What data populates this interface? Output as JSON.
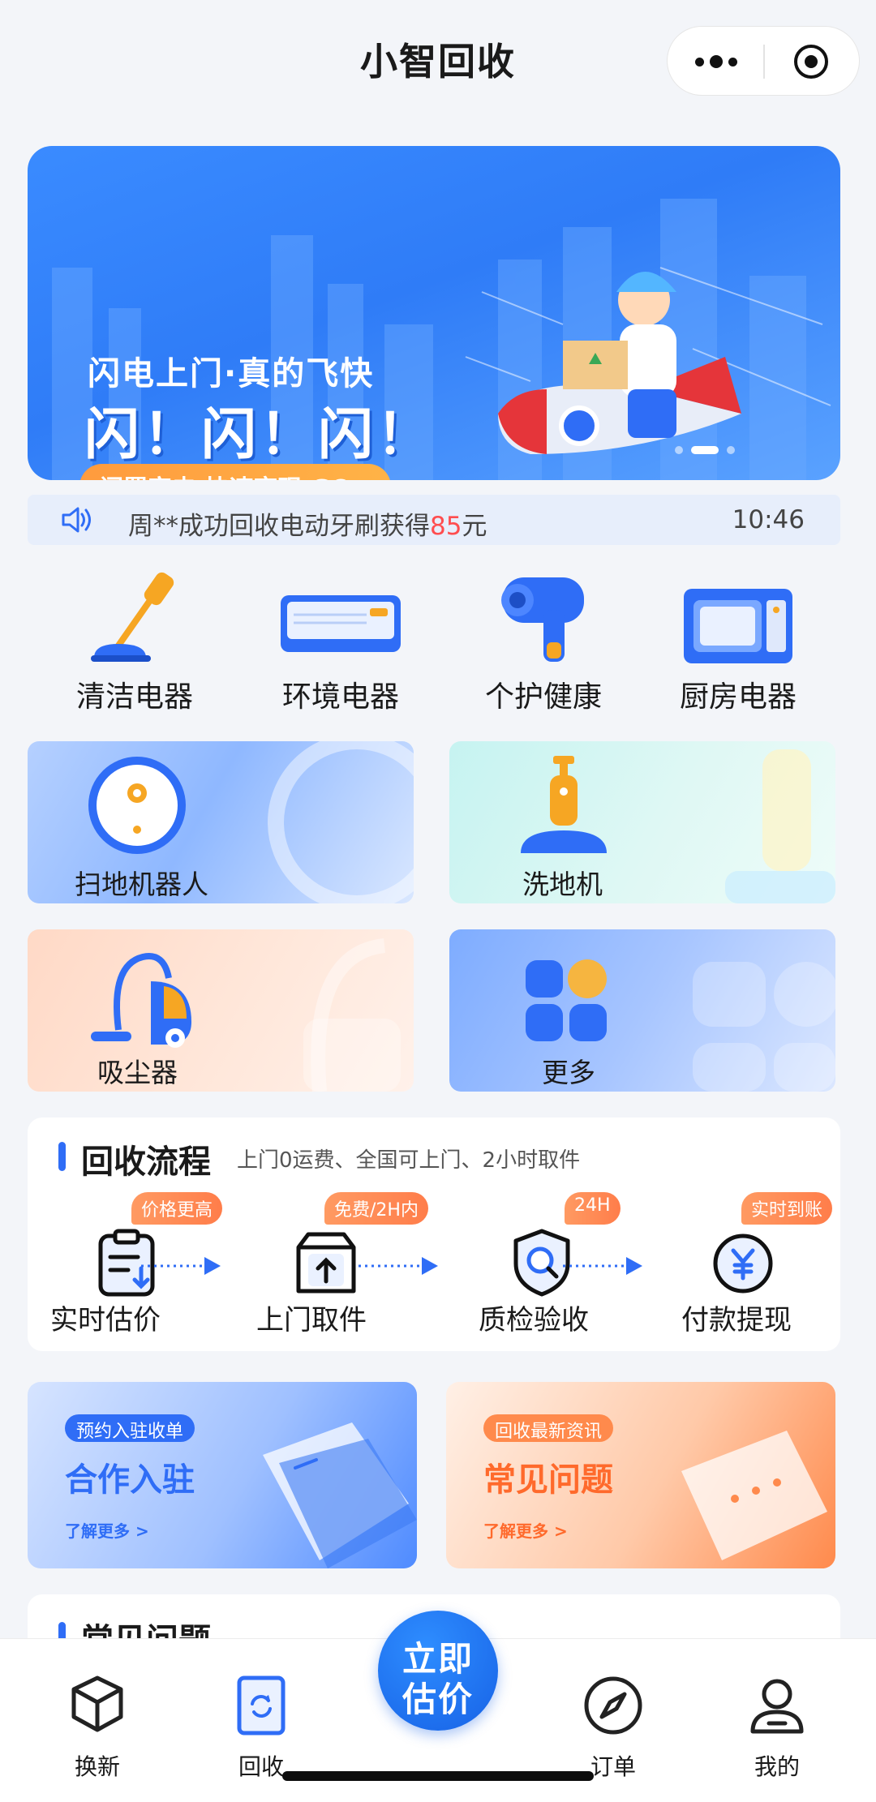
{
  "header": {
    "title": "小智回收"
  },
  "banner": {
    "subtitle": "闪电上门·真的飞快",
    "headline": "闪！闪！闪！",
    "cta": "闲置家电 快速变现 GO>"
  },
  "notice": {
    "message_prefix": "周**成功回收电动牙刷获得",
    "amount": "85",
    "message_suffix": "元",
    "time": "10:46"
  },
  "categories": [
    {
      "label": "清洁电器",
      "icon": "cordless-vacuum-icon"
    },
    {
      "label": "环境电器",
      "icon": "air-conditioner-icon"
    },
    {
      "label": "个护健康",
      "icon": "hair-dryer-icon"
    },
    {
      "label": "厨房电器",
      "icon": "microwave-icon"
    }
  ],
  "features": [
    {
      "label": "扫地机器人",
      "icon": "robot-vacuum-icon"
    },
    {
      "label": "洗地机",
      "icon": "floor-washer-icon"
    },
    {
      "label": "吸尘器",
      "icon": "canister-vacuum-icon"
    },
    {
      "label": "更多",
      "icon": "more-grid-icon"
    }
  ],
  "process": {
    "title": "回收流程",
    "subtitle": "上门0运费、全国可上门、2小时取件",
    "steps": [
      {
        "tag": "价格更高",
        "label": "实时估价",
        "icon": "clipboard-icon"
      },
      {
        "tag": "免费/2H内",
        "label": "上门取件",
        "icon": "box-upload-icon"
      },
      {
        "tag": "24H",
        "label": "质检验收",
        "icon": "shield-search-icon"
      },
      {
        "tag": "实时到账",
        "label": "付款提现",
        "icon": "yuan-coin-icon"
      }
    ]
  },
  "promos": [
    {
      "pill": "预约入驻收单",
      "title": "合作入驻",
      "more": "了解更多 >",
      "color": "#2f6df6"
    },
    {
      "pill": "回收最新资讯",
      "title": "常见问题",
      "more": "了解更多 >",
      "color": "#ff6a2c"
    }
  ],
  "faq": {
    "title": "常见问题"
  },
  "tabbar": {
    "tabs": [
      {
        "label": "换新",
        "icon": "cube-icon"
      },
      {
        "label": "回收",
        "icon": "recycle-phone-icon"
      },
      {
        "label": "订单",
        "icon": "compass-icon"
      },
      {
        "label": "我的",
        "icon": "user-icon"
      }
    ],
    "center": {
      "line1": "立即",
      "line2": "估价"
    }
  }
}
